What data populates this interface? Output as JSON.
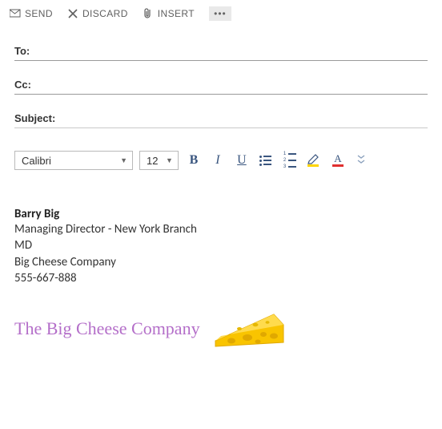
{
  "toolbar": {
    "send": "SEND",
    "discard": "DISCARD",
    "insert": "INSERT",
    "more": "•••"
  },
  "fields": {
    "to_label": "To:",
    "to_value": "",
    "cc_label": "Cc:",
    "cc_value": "",
    "subject_label": "Subject:",
    "subject_value": ""
  },
  "format": {
    "font": "Calibri",
    "size": "12"
  },
  "signature": {
    "name": "Barry Big",
    "title": "Managing Director - New York Branch",
    "role": "MD",
    "company": "Big Cheese Company",
    "phone": "555-667-888",
    "logo_text": "The Big Cheese Company"
  }
}
